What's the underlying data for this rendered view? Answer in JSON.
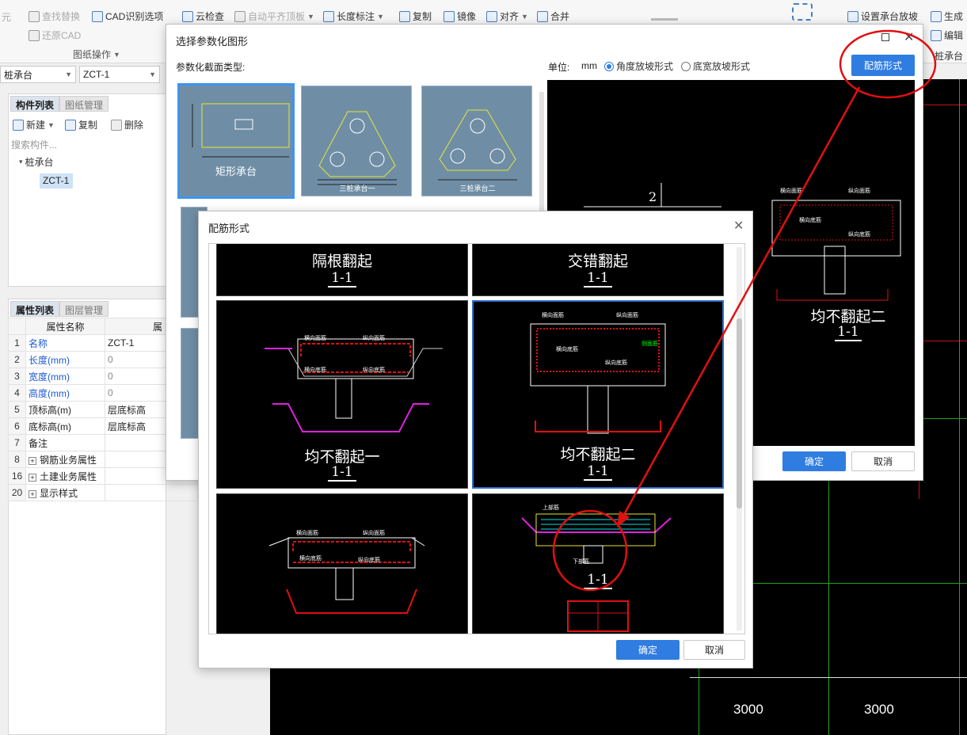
{
  "ribbon": {
    "left_items": [
      "查找替换",
      "还原CAD"
    ],
    "cad_options": "CAD识别选项",
    "group_label": "图纸操作",
    "cloud_check": "云检查",
    "auto_align": "自动平齐顶板",
    "length_mark": "长度标注",
    "copy": "复制",
    "mirror": "镜像",
    "align": "对齐",
    "merge": "合并",
    "set_slope": "设置承台放坡",
    "generate": "生成",
    "edit": "编辑",
    "pile_cap_edge": "桩承台"
  },
  "left": {
    "type_select": "桩承台",
    "item_select": "ZCT-1",
    "tabs": [
      "构件列表",
      "图纸管理"
    ],
    "toolbar": {
      "new": "新建",
      "copy": "复制",
      "delete": "删除"
    },
    "search_placeholder": "搜索构件...",
    "tree_root": "桩承台",
    "tree_child": "ZCT-1"
  },
  "props": {
    "tabs": [
      "属性列表",
      "图层管理"
    ],
    "header_name": "属性名称",
    "header_value": "属",
    "rows": [
      {
        "no": "1",
        "name": "名称",
        "value": "ZCT-1",
        "blue": true
      },
      {
        "no": "2",
        "name": "长度(mm)",
        "value": "0",
        "blue": true
      },
      {
        "no": "3",
        "name": "宽度(mm)",
        "value": "0",
        "blue": true
      },
      {
        "no": "4",
        "name": "高度(mm)",
        "value": "0",
        "blue": true
      },
      {
        "no": "5",
        "name": "顶标高(m)",
        "value": "层底标高",
        "blue": false
      },
      {
        "no": "6",
        "name": "底标高(m)",
        "value": "层底标高",
        "blue": false
      },
      {
        "no": "7",
        "name": "备注",
        "value": "",
        "blue": false
      },
      {
        "no": "8",
        "name": "钢筋业务属性",
        "value": "",
        "blue": false,
        "expand": true
      },
      {
        "no": "16",
        "name": "土建业务属性",
        "value": "",
        "blue": false,
        "expand": true
      },
      {
        "no": "20",
        "name": "显示样式",
        "value": "",
        "blue": false,
        "expand": true
      }
    ]
  },
  "cad": {
    "dim_left": "3000",
    "dim_right": "3000"
  },
  "dialog1": {
    "title": "选择参数化图形",
    "section_label": "参数化截面类型:",
    "unit_label": "单位:",
    "unit": "mm",
    "radio_angle": "角度放坡形式",
    "radio_width": "底宽放坡形式",
    "rebar_button": "配筋形式",
    "thumbs": [
      "矩形承台",
      "三桩承台一",
      "三桩承台二"
    ],
    "preview_caption": "均不翻起二",
    "preview_section": "1-1",
    "preview_num": "2",
    "ok": "确定",
    "cancel": "取消"
  },
  "dialog2": {
    "title": "配筋形式",
    "cells": [
      {
        "caption": "隔根翻起",
        "section": "1-1"
      },
      {
        "caption": "交错翻起",
        "section": "1-1"
      },
      {
        "caption": "均不翻起一",
        "section": "1-1"
      },
      {
        "caption": "均不翻起二",
        "section": "1-1"
      },
      {
        "caption": "",
        "section": ""
      },
      {
        "caption": "",
        "section": "1-1"
      }
    ],
    "labels": {
      "top_x": "横向面筋",
      "top_y": "纵向面筋",
      "bot_x": "横向底筋",
      "bot_y": "纵向底筋",
      "side": "侧面筋",
      "top_main": "上部筋",
      "bot_main": "下部筋"
    },
    "ok": "确定",
    "cancel": "取消"
  },
  "colors": {
    "accent": "#2f7de1",
    "annotation": "#e01010",
    "cad_grid": "#1ea51e"
  }
}
